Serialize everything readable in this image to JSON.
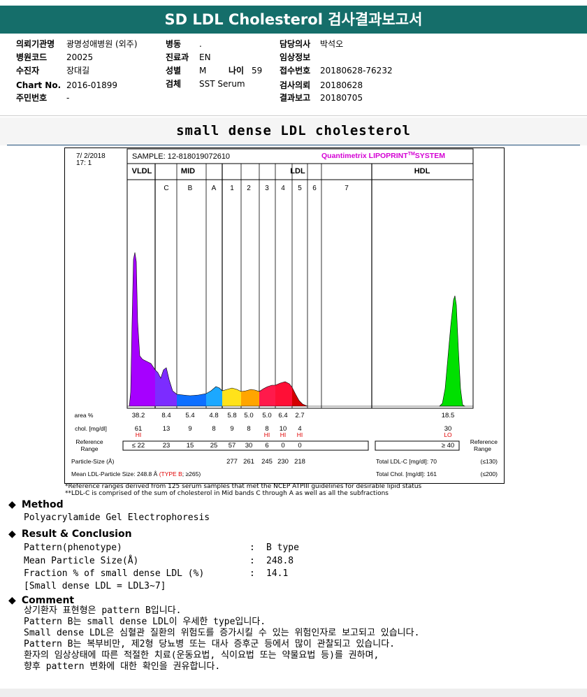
{
  "title": "SD LDL Cholesterol 검사결과보고서",
  "header": {
    "col1": [
      {
        "label": "의뢰기관명",
        "value": "광명성애병원 (외주)"
      },
      {
        "label": "병원코드",
        "value": "20025"
      },
      {
        "label": "수진자",
        "value": "장대길"
      },
      {
        "label": "Chart No.",
        "value": "2016-01899"
      },
      {
        "label": "주민번호",
        "value": "-"
      }
    ],
    "col2": [
      {
        "label": "병동",
        "value": "."
      },
      {
        "label": "진료과",
        "value": "EN"
      },
      {
        "label": "성별",
        "value": "M"
      },
      {
        "label": "검체",
        "value": "SST Serum"
      }
    ],
    "age_label": "나이",
    "age_value": "59",
    "col3": [
      {
        "label": "담당의사",
        "value": "박석오"
      },
      {
        "label": "임상정보",
        "value": ""
      },
      {
        "label": "접수번호",
        "value": "20180628-76232"
      },
      {
        "label": "검사의뢰",
        "value": "20180628"
      },
      {
        "label": "결과보고",
        "value": "20180705"
      }
    ]
  },
  "subtitle": "small dense LDL cholesterol",
  "report": {
    "date": "7/ 2/2018",
    "time": "17: 1",
    "sample": "SAMPLE:   12-818019072610",
    "brand": "Quantimetrix LIPOPRINT",
    "brand_tm": "TM",
    "brand_suffix": "SYSTEM",
    "groups": {
      "vldl": "VLDL",
      "mid": "MID",
      "ldl": "LDL",
      "hdl": "HDL"
    },
    "row_labels": {
      "area": "area %",
      "chol": "chol. [mg/dl]",
      "ref1": "Reference",
      "ref2": "Range",
      "psize": "Particle-Size (Å)",
      "mean_label": "Mean LDL-Particle Size:",
      "mean_value": "248.8 Å",
      "mean_type": "(TYPE B",
      "mean_limit": "; ≥265)",
      "total_ldl": "Total LDL-C [mg/dl]: 70",
      "total_ldl_ref": "(≤130)",
      "total_chol": "Total Chol. [mg/dl]:   161",
      "total_chol_ref": "(≤200)"
    },
    "footnote1": "*Reference ranges derived from 125 serum samples that met the NCEP ATPIII guidelines for desirable lipid status",
    "footnote2": "**LDL-C is comprised of the sum of cholesterol in Mid bands C through A as well as all the subfractions"
  },
  "chart_data": {
    "type": "table",
    "bands": [
      "VLDL",
      "C",
      "B",
      "A",
      "1",
      "2",
      "3",
      "4",
      "5",
      "6",
      "7",
      "HDL"
    ],
    "area_percent": [
      "38.2",
      "8.4",
      "5.4",
      "4.8",
      "5.8",
      "5.0",
      "5.0",
      "6.4",
      "2.7",
      "",
      "",
      "18.5"
    ],
    "chol_mg_dl": [
      "61",
      "13",
      "9",
      "8",
      "9",
      "8",
      "8",
      "10",
      "4",
      "",
      "",
      "30"
    ],
    "flags": [
      "HI",
      "",
      "",
      "",
      "",
      "",
      "HI",
      "HI",
      "HI",
      "",
      "",
      "LO"
    ],
    "reference_range": [
      "≤ 22",
      "23",
      "15",
      "25",
      "57",
      "30",
      "6",
      "0",
      "0",
      "",
      "",
      "≥ 40"
    ],
    "particle_size": [
      "",
      "",
      "",
      "",
      "277",
      "261",
      "245",
      "230",
      "218",
      "",
      "",
      ""
    ],
    "band_colors": [
      "#a600ff",
      "#7c2cff",
      "#0d6fff",
      "#1ca8ff",
      "#ffe21a",
      "#ffa500",
      "#ff1a4b",
      "#ff0f36",
      "#d40000",
      "",
      "",
      "#00e000"
    ]
  },
  "sections": {
    "method_title": "Method",
    "method_text": "Polyacrylamide Gel Electrophoresis",
    "result_title": "Result & Conclusion",
    "results": [
      {
        "label": "Pattern(phenotype)",
        "value": "B type"
      },
      {
        "label": "Mean Particle Size(Å)",
        "value": "248.8"
      },
      {
        "label": "Fraction % of small dense LDL (%)",
        "value": "14.1"
      }
    ],
    "result_note": "[Small dense LDL = LDL3~7]",
    "colon": ":",
    "comment_title": "Comment",
    "comments": [
      "상기환자 표현형은 pattern B입니다.",
      "Pattern B는 small dense LDL이 우세한 type입니다.",
      "Small dense LDL은 심혈관 질환의 위험도를 증가시킬 수 있는 위험인자로 보고되고 있습니다.",
      "Pattern B는 복부비만, 제2형 당뇨병 또는 대사 증후군 등에서 많이 관찰되고 있습니다.",
      "환자의 임상상태에 따른 적절한 치료(운동요법, 식이요법 또는 약물요법 등)를 권하며,",
      "향후 pattern 변화에 대한 확인을 권유합니다."
    ]
  }
}
